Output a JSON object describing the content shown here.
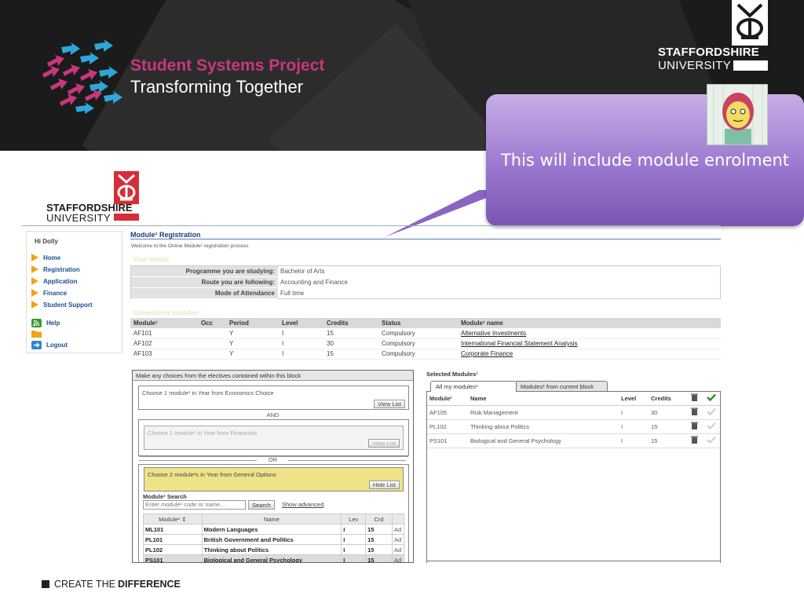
{
  "banner": {
    "project_title": "Student Systems Project",
    "project_subtitle": "Transforming Together",
    "university_line1": "STAFFORDSHIRE",
    "university_line2": "UNIVERSITY"
  },
  "callout": {
    "text": "This will include module enrolment"
  },
  "app": {
    "logo_line1": "STAFFORDSHIRE",
    "logo_line2": "UNIVERSITY",
    "greeting": "Hi Dolly",
    "nav": [
      {
        "label": "Home",
        "icon": "arrow-icon"
      },
      {
        "label": "Registration",
        "icon": "arrow-icon"
      },
      {
        "label": "Application",
        "icon": "arrow-icon"
      },
      {
        "label": "Finance",
        "icon": "arrow-icon"
      },
      {
        "label": "Student Support",
        "icon": "arrow-icon"
      }
    ],
    "help_label": "Help",
    "logout_label": "Logout",
    "page_title": "Module¹ Registration",
    "welcome": "Welcome to the Online Module¹ registration process",
    "details_heading": "Your details",
    "details": [
      {
        "label": "Programme you are studying:",
        "value": "Bachelor of Arts"
      },
      {
        "label": "Route you are following:",
        "value": "Accounting and Finance"
      },
      {
        "label": "Mode of Attendance",
        "value": "Full time"
      }
    ],
    "compulsory_heading": "Compulsory modules¹",
    "compulsory_headers": [
      "Module¹",
      "Occ",
      "Period",
      "Level",
      "Credits",
      "Status",
      "Module¹ name"
    ],
    "compulsory_rows": [
      [
        "AF101",
        "",
        "Y",
        "I",
        "15",
        "Compulsory",
        "Alternative Investments"
      ],
      [
        "AF102",
        "",
        "Y",
        "I",
        "30",
        "Compulsory",
        "International Financial Statement Analysis"
      ],
      [
        "AF103",
        "",
        "Y",
        "I",
        "15",
        "Compulsory",
        "Corporate Finance"
      ]
    ],
    "electives": {
      "header": "Make any choices from the electives contained within this block",
      "choice1": "Choose 1 module¹ in Year from Economics Choice",
      "view_list": "View List",
      "and": "AND",
      "choice2": "Choose 1 module¹ in Year from Financials",
      "view_list2": "View List",
      "or": "OR",
      "choice3": "Choose 2 module¹s in Year from General Options",
      "hide_list": "Hide List",
      "search_label": "Module¹ Search",
      "search_placeholder": "Enter module¹ code or name...",
      "search_button": "Search",
      "show_advanced": "Show advanced",
      "list_headers": [
        "Module¹ ⇕",
        "Name",
        "Lev",
        "Crd"
      ],
      "list_rows": [
        {
          "code": "ML101",
          "name": "Modern Languages",
          "lev": "I",
          "crd": "15",
          "add": "Ad"
        },
        {
          "code": "PL101",
          "name": "British Government and Politics",
          "lev": "I",
          "crd": "15",
          "add": "Ad"
        },
        {
          "code": "PL102",
          "name": "Thinking about Politics",
          "lev": "I",
          "crd": "15",
          "add": "Ad"
        },
        {
          "code": "PS101",
          "name": "Biological and General Psychology",
          "lev": "I",
          "crd": "15",
          "add": "Ad"
        }
      ]
    },
    "selected": {
      "heading": "Selected Modules¹",
      "tab_all": "All my modules¹",
      "tab_current": "Modules¹ from current block",
      "headers": [
        "Module¹",
        "Name",
        "Level",
        "Credits"
      ],
      "rows": [
        {
          "code": "AF105",
          "name": "Risk Management",
          "level": "I",
          "credits": "30"
        },
        {
          "code": "PL102",
          "name": "Thinking about Politics",
          "level": "I",
          "credits": "15"
        },
        {
          "code": "PS101",
          "name": "Biological and General Psychology",
          "level": "I",
          "credits": "15"
        }
      ]
    }
  },
  "footer": {
    "text_plain": "CREATE THE ",
    "text_bold": "DIFFERENCE"
  },
  "colors": {
    "brand_magenta": "#c8377d",
    "brand_red": "#d72d38",
    "callout_purple": "#9a78cf",
    "nav_arrow": "#f2a414"
  }
}
